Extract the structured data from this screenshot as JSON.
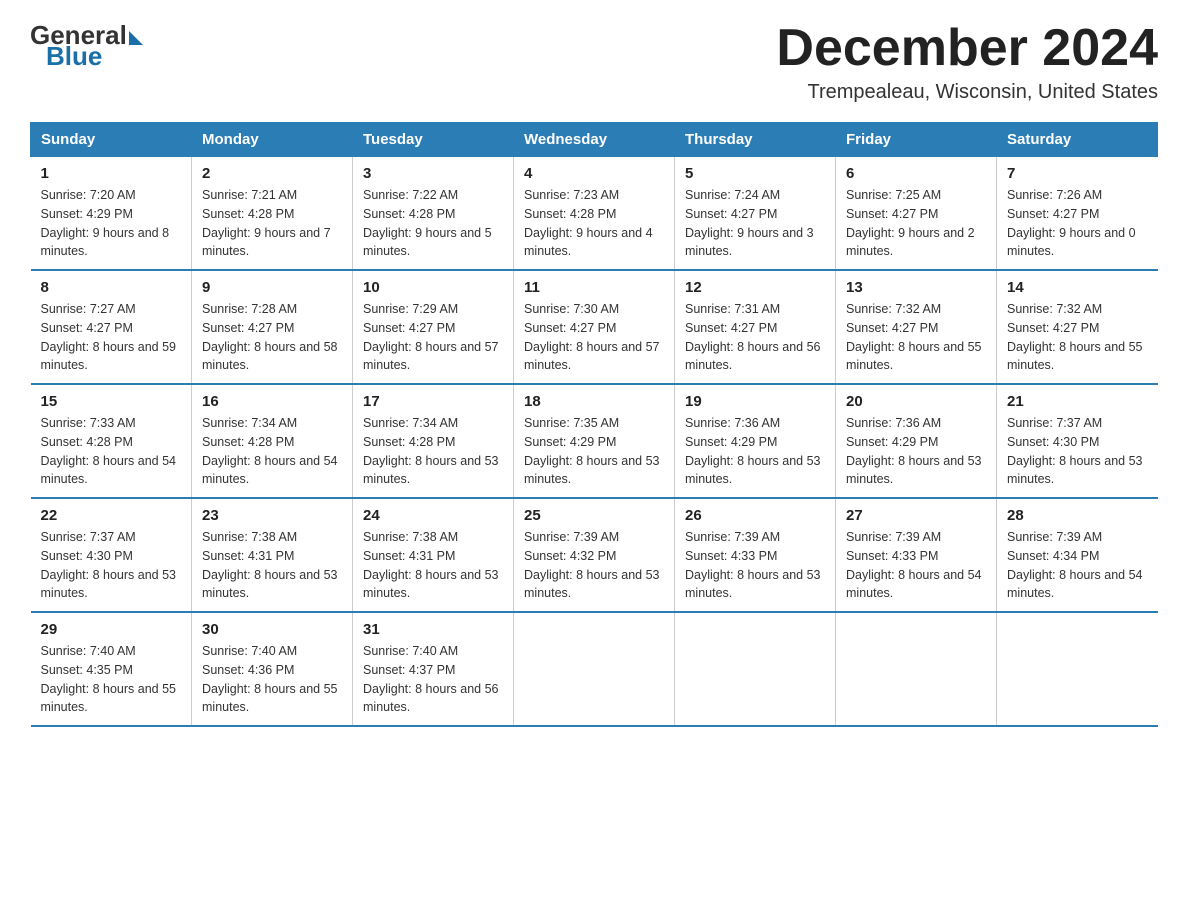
{
  "header": {
    "logo_general": "General",
    "logo_blue": "Blue",
    "month_year": "December 2024",
    "location": "Trempealeau, Wisconsin, United States"
  },
  "days_of_week": [
    "Sunday",
    "Monday",
    "Tuesday",
    "Wednesday",
    "Thursday",
    "Friday",
    "Saturday"
  ],
  "weeks": [
    [
      {
        "day": "1",
        "sunrise": "7:20 AM",
        "sunset": "4:29 PM",
        "daylight": "9 hours and 8 minutes."
      },
      {
        "day": "2",
        "sunrise": "7:21 AM",
        "sunset": "4:28 PM",
        "daylight": "9 hours and 7 minutes."
      },
      {
        "day": "3",
        "sunrise": "7:22 AM",
        "sunset": "4:28 PM",
        "daylight": "9 hours and 5 minutes."
      },
      {
        "day": "4",
        "sunrise": "7:23 AM",
        "sunset": "4:28 PM",
        "daylight": "9 hours and 4 minutes."
      },
      {
        "day": "5",
        "sunrise": "7:24 AM",
        "sunset": "4:27 PM",
        "daylight": "9 hours and 3 minutes."
      },
      {
        "day": "6",
        "sunrise": "7:25 AM",
        "sunset": "4:27 PM",
        "daylight": "9 hours and 2 minutes."
      },
      {
        "day": "7",
        "sunrise": "7:26 AM",
        "sunset": "4:27 PM",
        "daylight": "9 hours and 0 minutes."
      }
    ],
    [
      {
        "day": "8",
        "sunrise": "7:27 AM",
        "sunset": "4:27 PM",
        "daylight": "8 hours and 59 minutes."
      },
      {
        "day": "9",
        "sunrise": "7:28 AM",
        "sunset": "4:27 PM",
        "daylight": "8 hours and 58 minutes."
      },
      {
        "day": "10",
        "sunrise": "7:29 AM",
        "sunset": "4:27 PM",
        "daylight": "8 hours and 57 minutes."
      },
      {
        "day": "11",
        "sunrise": "7:30 AM",
        "sunset": "4:27 PM",
        "daylight": "8 hours and 57 minutes."
      },
      {
        "day": "12",
        "sunrise": "7:31 AM",
        "sunset": "4:27 PM",
        "daylight": "8 hours and 56 minutes."
      },
      {
        "day": "13",
        "sunrise": "7:32 AM",
        "sunset": "4:27 PM",
        "daylight": "8 hours and 55 minutes."
      },
      {
        "day": "14",
        "sunrise": "7:32 AM",
        "sunset": "4:27 PM",
        "daylight": "8 hours and 55 minutes."
      }
    ],
    [
      {
        "day": "15",
        "sunrise": "7:33 AM",
        "sunset": "4:28 PM",
        "daylight": "8 hours and 54 minutes."
      },
      {
        "day": "16",
        "sunrise": "7:34 AM",
        "sunset": "4:28 PM",
        "daylight": "8 hours and 54 minutes."
      },
      {
        "day": "17",
        "sunrise": "7:34 AM",
        "sunset": "4:28 PM",
        "daylight": "8 hours and 53 minutes."
      },
      {
        "day": "18",
        "sunrise": "7:35 AM",
        "sunset": "4:29 PM",
        "daylight": "8 hours and 53 minutes."
      },
      {
        "day": "19",
        "sunrise": "7:36 AM",
        "sunset": "4:29 PM",
        "daylight": "8 hours and 53 minutes."
      },
      {
        "day": "20",
        "sunrise": "7:36 AM",
        "sunset": "4:29 PM",
        "daylight": "8 hours and 53 minutes."
      },
      {
        "day": "21",
        "sunrise": "7:37 AM",
        "sunset": "4:30 PM",
        "daylight": "8 hours and 53 minutes."
      }
    ],
    [
      {
        "day": "22",
        "sunrise": "7:37 AM",
        "sunset": "4:30 PM",
        "daylight": "8 hours and 53 minutes."
      },
      {
        "day": "23",
        "sunrise": "7:38 AM",
        "sunset": "4:31 PM",
        "daylight": "8 hours and 53 minutes."
      },
      {
        "day": "24",
        "sunrise": "7:38 AM",
        "sunset": "4:31 PM",
        "daylight": "8 hours and 53 minutes."
      },
      {
        "day": "25",
        "sunrise": "7:39 AM",
        "sunset": "4:32 PM",
        "daylight": "8 hours and 53 minutes."
      },
      {
        "day": "26",
        "sunrise": "7:39 AM",
        "sunset": "4:33 PM",
        "daylight": "8 hours and 53 minutes."
      },
      {
        "day": "27",
        "sunrise": "7:39 AM",
        "sunset": "4:33 PM",
        "daylight": "8 hours and 54 minutes."
      },
      {
        "day": "28",
        "sunrise": "7:39 AM",
        "sunset": "4:34 PM",
        "daylight": "8 hours and 54 minutes."
      }
    ],
    [
      {
        "day": "29",
        "sunrise": "7:40 AM",
        "sunset": "4:35 PM",
        "daylight": "8 hours and 55 minutes."
      },
      {
        "day": "30",
        "sunrise": "7:40 AM",
        "sunset": "4:36 PM",
        "daylight": "8 hours and 55 minutes."
      },
      {
        "day": "31",
        "sunrise": "7:40 AM",
        "sunset": "4:37 PM",
        "daylight": "8 hours and 56 minutes."
      },
      null,
      null,
      null,
      null
    ]
  ]
}
